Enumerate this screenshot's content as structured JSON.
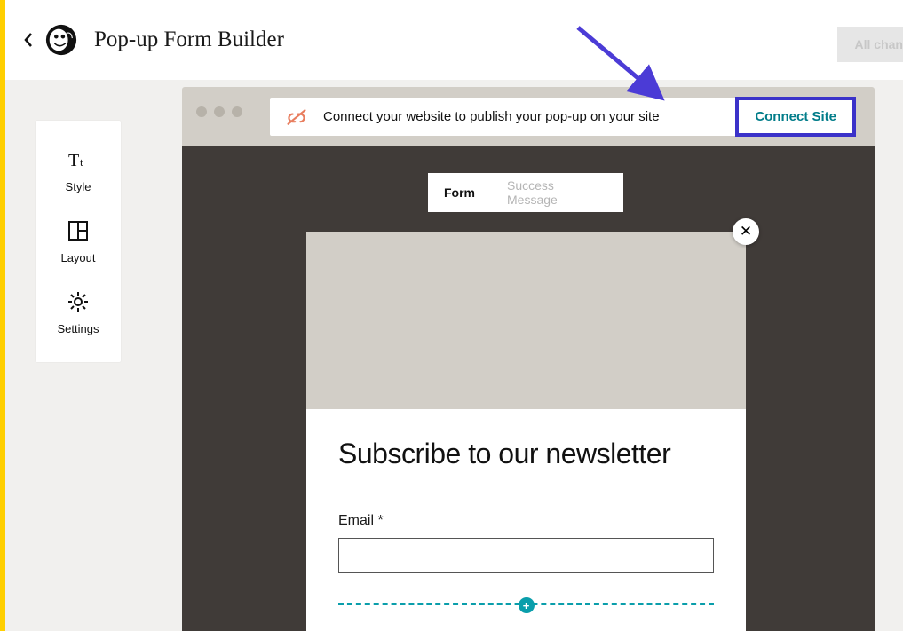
{
  "accent_color": "#ffcf00",
  "header": {
    "title": "Pop-up Form Builder",
    "all_changes_label": "All chan"
  },
  "sidebar": {
    "items": [
      {
        "icon": "type-icon",
        "label": "Style"
      },
      {
        "icon": "layout-icon",
        "label": "Layout"
      },
      {
        "icon": "gear-icon",
        "label": "Settings"
      }
    ]
  },
  "connect_bar": {
    "icon": "unlink-icon",
    "message": "Connect your website to publish your pop-up on your site",
    "button_label": "Connect Site",
    "highlight_color": "#3b32c9"
  },
  "tabs": [
    {
      "label": "Form",
      "active": true
    },
    {
      "label": "Success Message",
      "active": false
    }
  ],
  "popup": {
    "close_icon": "x-icon",
    "heading": "Subscribe to our newsletter",
    "email_label": "Email *",
    "add_icon": "plus-icon"
  },
  "annotation_arrow_color": "#4b3bd6"
}
